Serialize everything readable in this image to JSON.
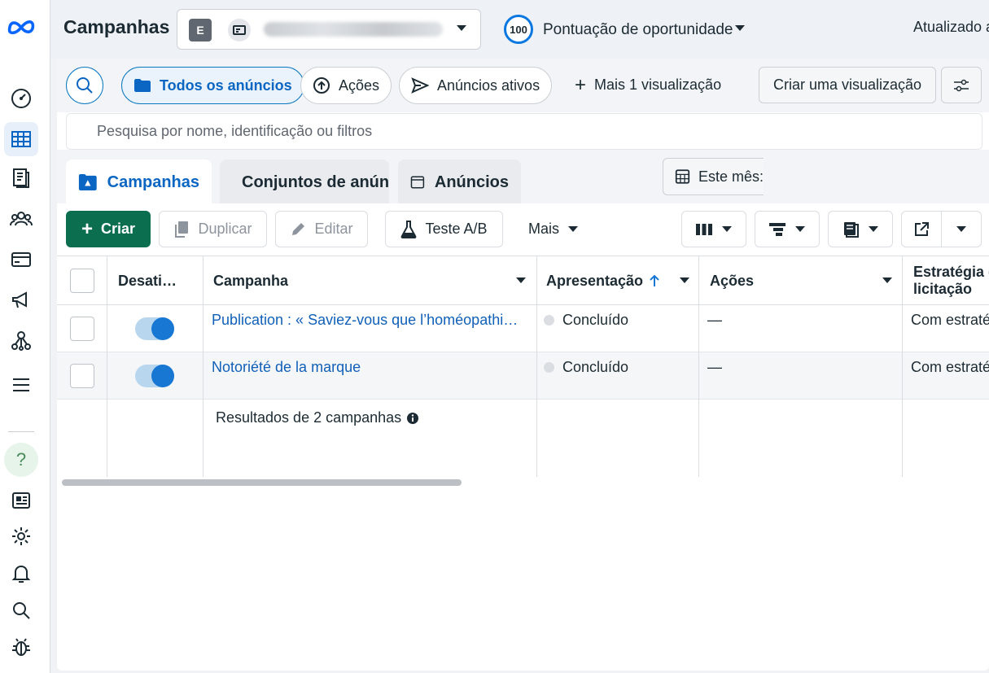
{
  "app": {
    "title": "Campanhas",
    "brand_color": "#0866ff",
    "accent_color": "#0a66c2",
    "create_color": "#0b6e4f"
  },
  "rail": {
    "items": [
      {
        "icon": "gauge-icon"
      },
      {
        "icon": "table-grid-icon",
        "active": true
      },
      {
        "icon": "documents-icon"
      },
      {
        "icon": "audience-icon"
      },
      {
        "icon": "billing-card-icon"
      },
      {
        "icon": "megaphone-icon"
      },
      {
        "icon": "network-icon"
      },
      {
        "icon": "menu-icon"
      },
      {
        "icon": "help-icon",
        "label": "?"
      },
      {
        "icon": "news-icon"
      },
      {
        "icon": "gear-icon"
      },
      {
        "icon": "bell-icon"
      },
      {
        "icon": "search-icon"
      },
      {
        "icon": "bug-icon"
      }
    ]
  },
  "header": {
    "account_badge": "E",
    "score_value": "100",
    "score_label": "Pontuação de oportunidade",
    "updated_label": "Atualizado a"
  },
  "views": {
    "all_ads": "Todos os anúncios",
    "actions": "Ações",
    "active_ads": "Anúncios ativos",
    "more_views": "Mais 1 visualização",
    "create_view": "Criar uma visualização"
  },
  "search": {
    "placeholder": "Pesquisa por nome, identificação ou filtros"
  },
  "tabs": [
    {
      "label": "Campanhas",
      "active": true
    },
    {
      "label": "Conjuntos de anúncios"
    },
    {
      "label": "Anúncios"
    }
  ],
  "date_range": {
    "label": "Este mês:"
  },
  "toolbar": {
    "create": "Criar",
    "duplicate": "Duplicar",
    "edit": "Editar",
    "ab_test": "Teste A/B",
    "more": "Mais"
  },
  "table": {
    "columns": {
      "toggle": "Desati…",
      "campaign": "Campanha",
      "delivery": "Apresentação",
      "actions": "Ações",
      "strategy_line1": "Estratégia d",
      "strategy_line2": "licitação"
    },
    "rows": [
      {
        "name": "Publication : « Saviez-vous que l’homéopathie …",
        "delivery": "Concluído",
        "actions": "—",
        "strategy": "Com estraté",
        "on": true
      },
      {
        "name": "Notoriété de la marque",
        "delivery": "Concluído",
        "actions": "—",
        "strategy": "Com estraté",
        "on": true
      }
    ],
    "results": "Resultados de 2 campanhas"
  }
}
